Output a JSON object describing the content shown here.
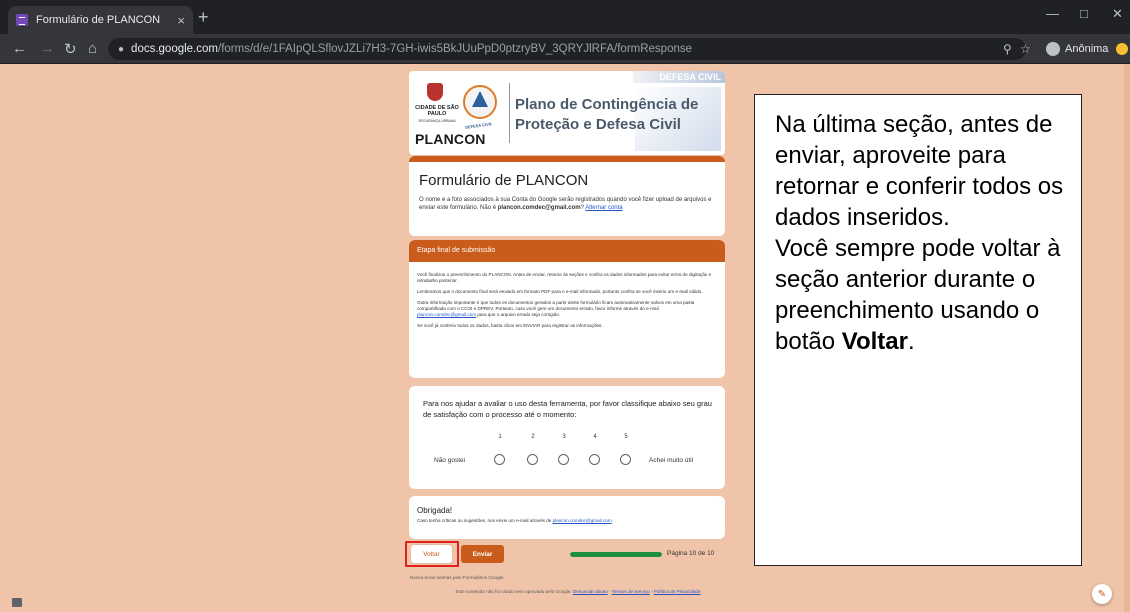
{
  "browser": {
    "tab_title": "Formulário de PLANCON",
    "tab_close": "×",
    "new_tab": "+",
    "url_host": "docs.google.com",
    "url_path": "/forms/d/e/1FAIpQLSflovJZLi7H3-7GH-iwis5BkJUuPpD0ptzryBV_3QRYJlRFA/formResponse",
    "profile_label": "Anônima",
    "nav_icons": [
      "back-icon",
      "forward-icon",
      "reload-icon",
      "home-icon"
    ],
    "window_buttons": [
      "minimize-icon",
      "maximize-icon",
      "close-icon"
    ]
  },
  "header_image": {
    "banner": "DEFESA CIVIL",
    "city_name": "CIDADE DE SÃO PAULO",
    "city_sub": "SEGURANÇA URBANA",
    "logo_caption": "DEFESA CIVIL",
    "brand": "PLANCON",
    "title_line1": "Plano de Contingência de",
    "title_line2": "Proteção e Defesa Civil"
  },
  "form": {
    "title": "Formulário de PLANCON",
    "info_part1": "O nome e a foto associados à sua Conta do Google serão registrados quando você fizer upload de arquivos e enviar este formulário. Não é ",
    "info_email": "plancon.comdec@gmail.com",
    "info_part2": "? ",
    "switch_account": "Alternar conta"
  },
  "section": {
    "header": "Etapa final de submissão",
    "p1": "Você finalizou o preenchimento do PLANCON. Antes de enviar, retorne às seções e confira os dados informados para evitar erros de digitação e retrabalho posterior.",
    "p2": "Lembramos que o documento final será enviado em formato PDF para o e-mail informado, portanto confira se você inseriu um e-mail válido.",
    "p3a": "Outra informação importante é que todos os documentos gerados a partir deste formulário ficam automaticamente salvos em uma pasta compartilhada com o CCOI e DPREV. Portanto, caso você gere um documento errado, favor informe através do e-mail ",
    "p3_link": "plancon.comdec@gmail.com",
    "p3b": " para que o arquivo errado seja corrigido.",
    "p4": "Se você já conferiu todos os dados, basta clicar em ENVIAR para registrar as informações."
  },
  "rating": {
    "question": "Para nos ajudar a avaliar o uso desta ferramenta, por favor classifique abaixo seu grau de satisfação com o processo até o momento:",
    "scale": [
      "1",
      "2",
      "3",
      "4",
      "5"
    ],
    "low_label": "Não gostei",
    "high_label": "Achei muito útil"
  },
  "thanks": {
    "title": "Obrigada!",
    "text": "Caso tenha críticas ou sugestões, nos envie um e-mail através de ",
    "link": "plancon.comdec@gmail.com",
    "text_end": "."
  },
  "navigation": {
    "back_label": "Voltar",
    "send_label": "Enviar",
    "page_indicator": "Página 10 de 10",
    "progress_fraction": 1.0
  },
  "footer": {
    "warning": "Nunca envie senhas pelo Formulários Google.",
    "note": "Este conteúdo não foi criado nem aprovado pelo Google. ",
    "abuse_link": "Denunciar abuso",
    "sep1": " - ",
    "terms_link": "Termos de Serviço",
    "sep2": " - ",
    "privacy_link": "Política de Privacidade"
  },
  "callout": {
    "line1": "Na última seção, antes de enviar, aproveite para retornar e conferir todos os dados inseridos.",
    "line2": "Você sempre pode voltar à seção anterior durante o preenchimento usando o botão ",
    "bold_word": "Voltar",
    "end": "."
  },
  "colors": {
    "page_bg": "#f0c4a8",
    "accent": "#c95c1a",
    "highlight": "#e0221e",
    "progress": "#1e8e3e"
  }
}
